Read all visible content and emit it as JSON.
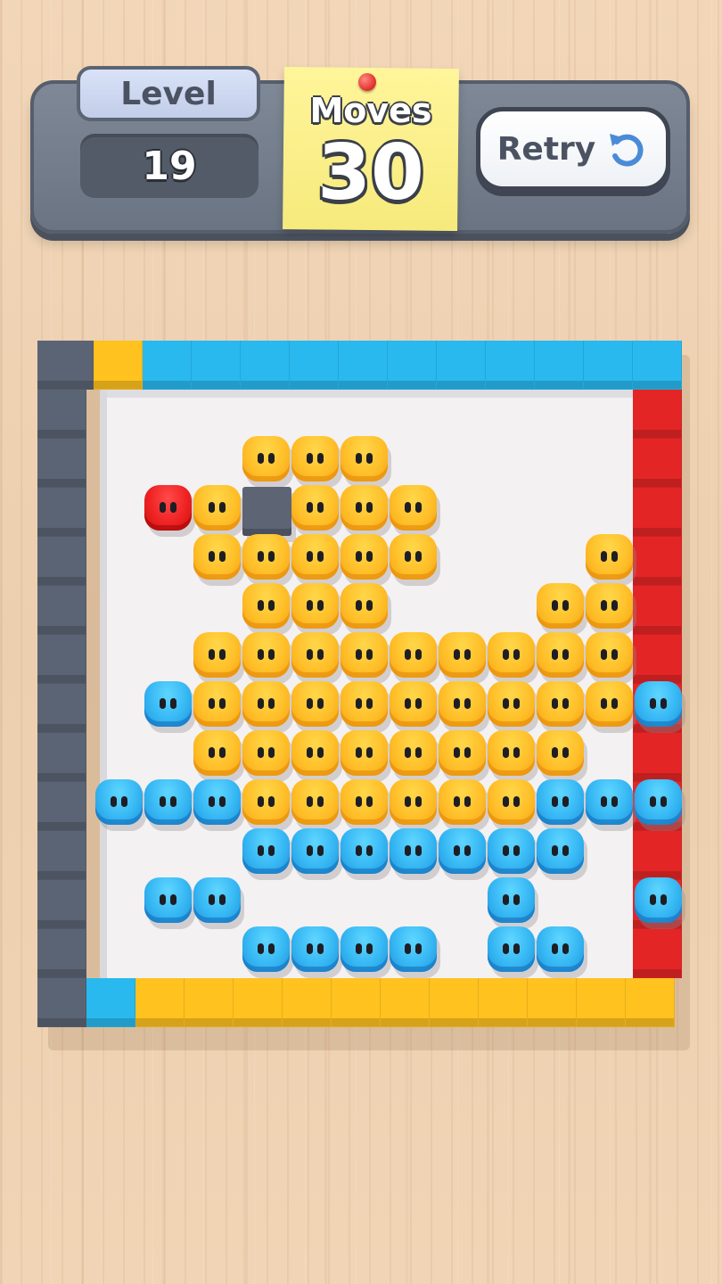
{
  "hud": {
    "level_label": "Level",
    "level_value": "19",
    "moves_label": "Moves",
    "moves_value": "30",
    "retry_label": "Retry",
    "retry_icon": "restart-icon"
  },
  "colors": {
    "yellow": "#ffc02a",
    "blue": "#37b8f4",
    "red": "#ef2323",
    "stone": "#5d6474",
    "wall_gray": "#5b6474",
    "wall_blue": "#29b9ef",
    "wall_red": "#e42526",
    "wall_yellow": "#ffc21f",
    "wall_orange": "#ffb81a"
  },
  "board": {
    "grid_size": 14,
    "walls": [
      {
        "side": "left",
        "color": "gray",
        "cells": 14
      },
      {
        "side": "top",
        "color_sequence": [
          "gray",
          "yellow",
          "blue",
          "blue",
          "blue",
          "blue",
          "blue",
          "blue",
          "blue",
          "blue",
          "blue",
          "blue",
          "blue"
        ]
      },
      {
        "side": "right",
        "color": "red",
        "cells": 12
      },
      {
        "side": "bottom",
        "color_sequence": [
          "gray",
          "blue",
          "yellow",
          "yellow",
          "yellow",
          "yellow",
          "yellow",
          "yellow",
          "yellow",
          "yellow",
          "yellow",
          "yellow",
          "yellow"
        ]
      }
    ],
    "rows": [
      "............",
      "...YYY......",
      ".RYSYYY.....",
      "..YYYYY...Y.",
      "...YYY...YY.",
      "..YYYYYYYYY.",
      ".BYYYYYYYYYB",
      "..YYYYYYYY..",
      "BBBYYYYYYBBB",
      "...BBBBBBB..",
      ".BB.....B..B",
      "...BBBB.BB..",
      "............"
    ]
  }
}
